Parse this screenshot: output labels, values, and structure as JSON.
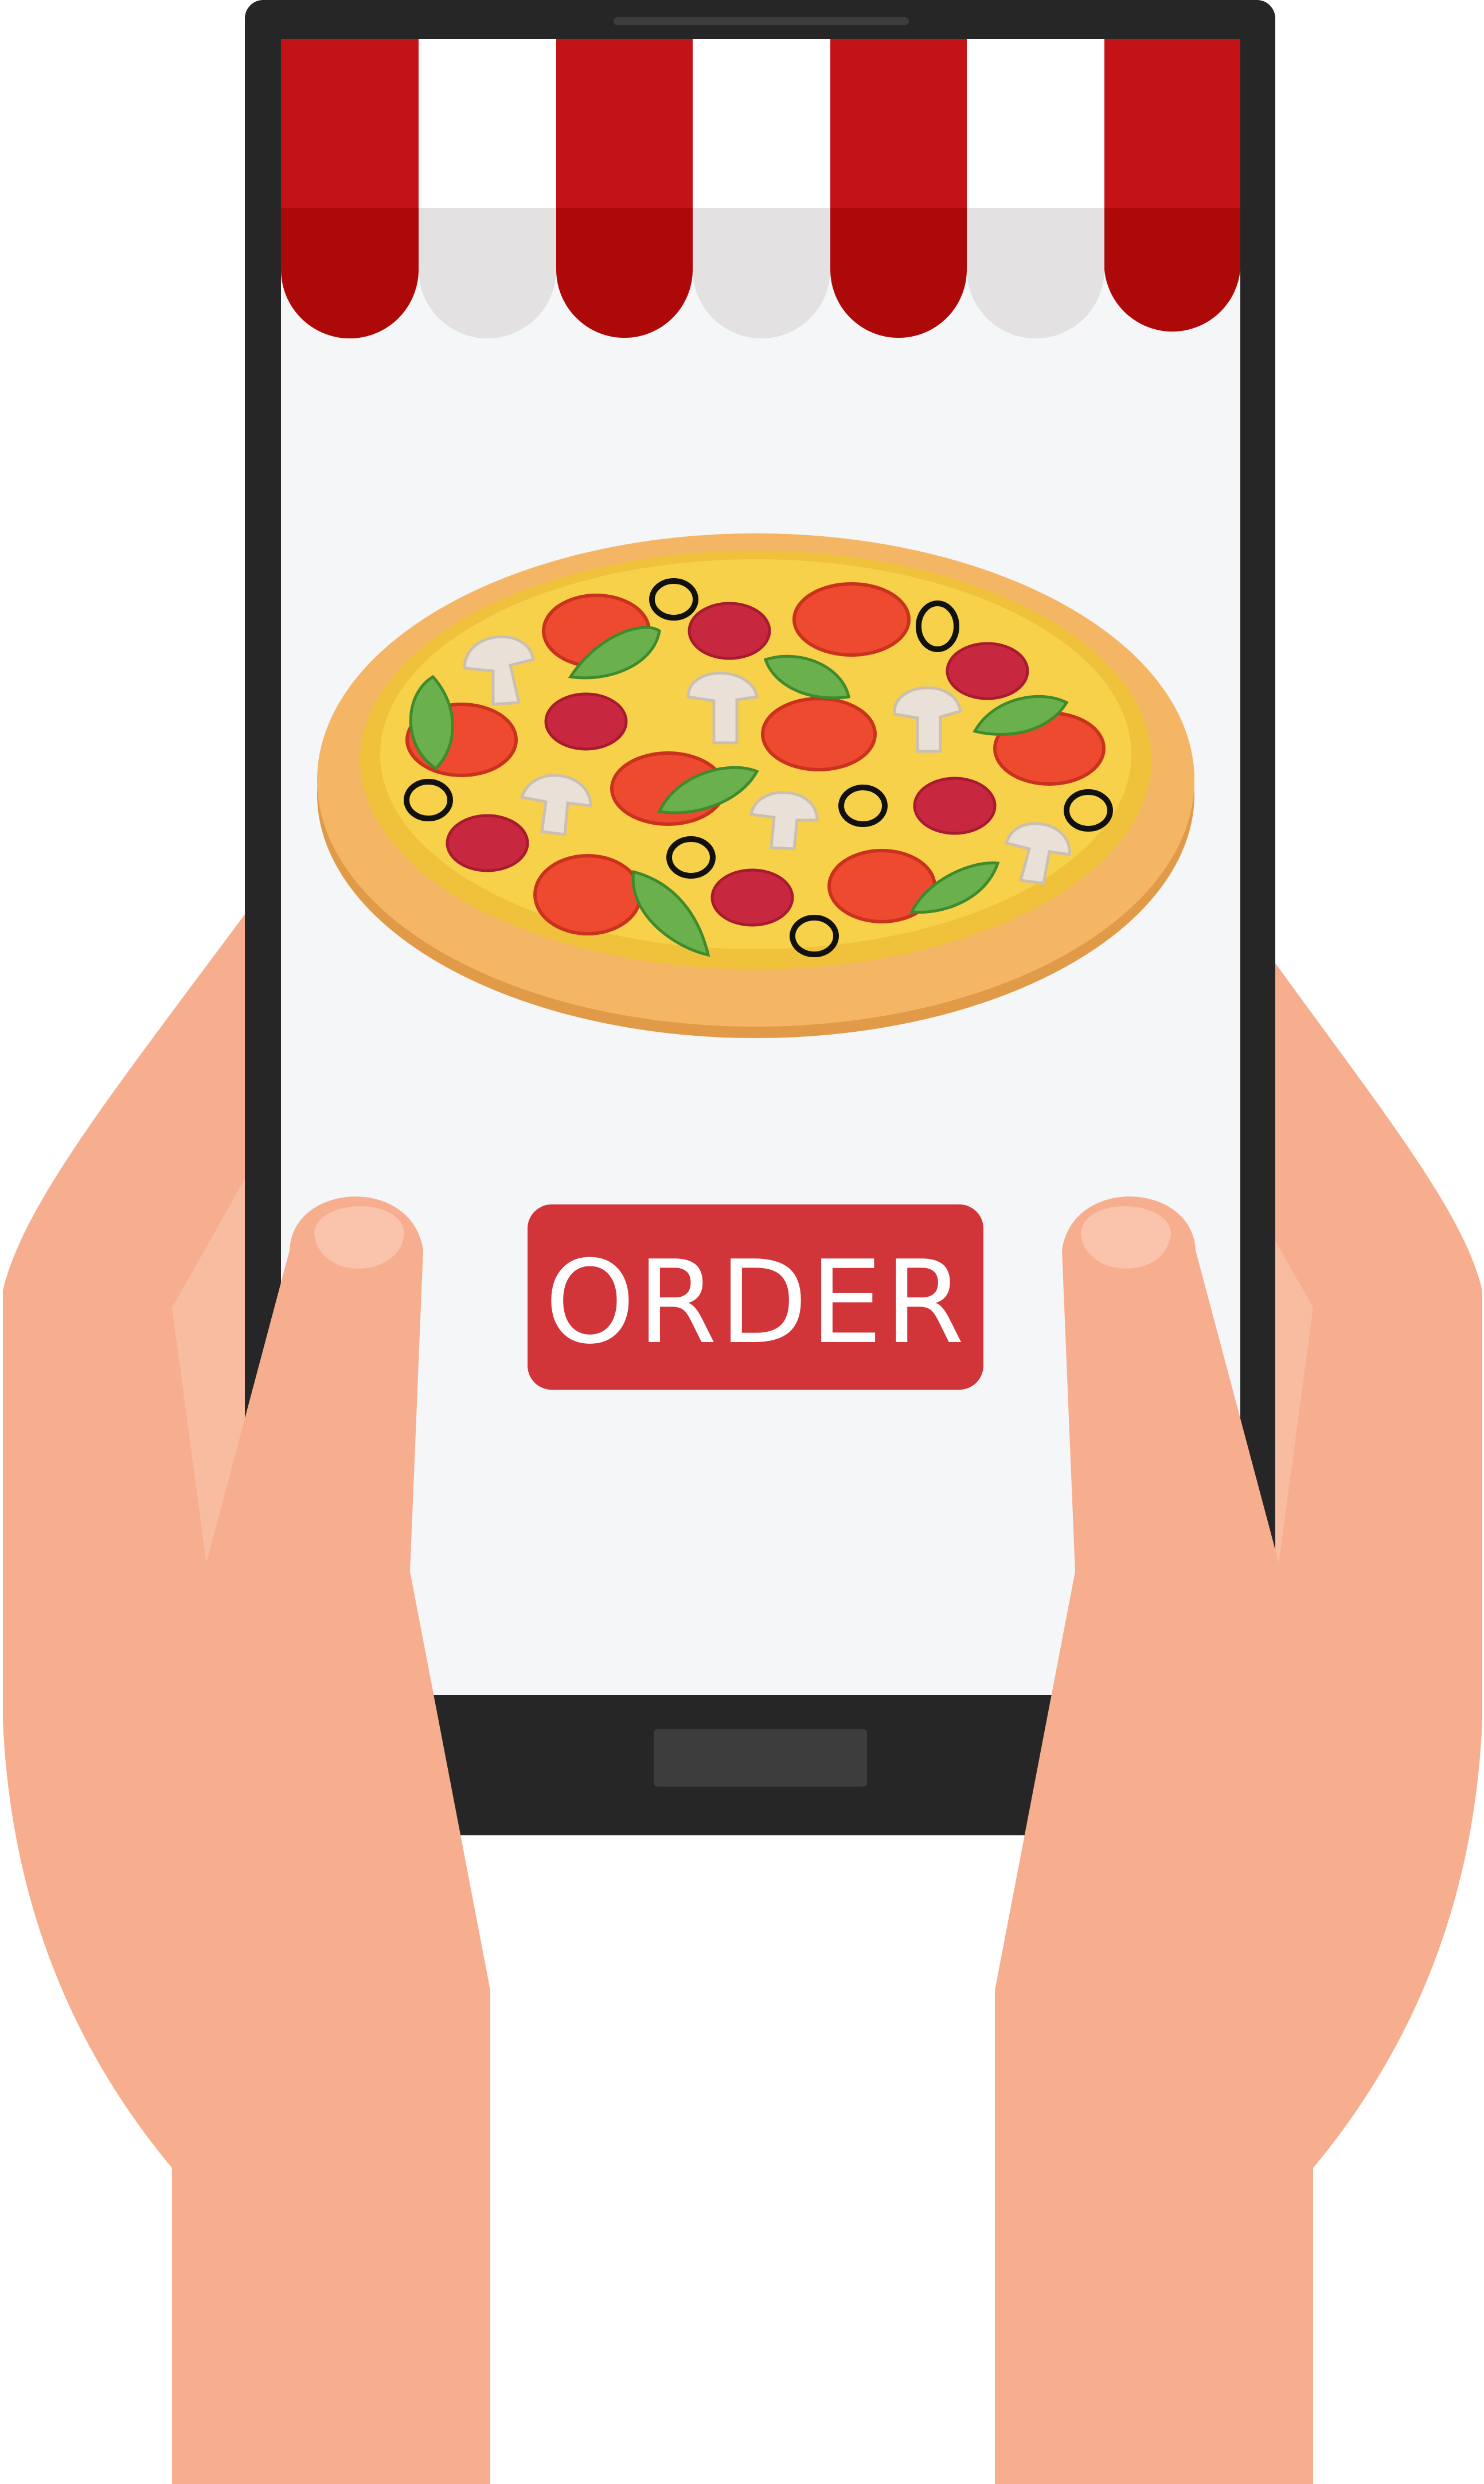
{
  "order_button": {
    "label": "ORDER"
  },
  "colors": {
    "phone_body": "#262626",
    "screen": "#f4f6f7",
    "awning_red": "#c41317",
    "awning_red_dark": "#ad0909",
    "awning_white": "#ffffff",
    "awning_white_shade": "#e3e1e2",
    "button_red": "#d13539",
    "skin": "#f7ae8e",
    "skin_light": "#f9c4ab",
    "crust": "#f4b565",
    "cheese": "#f7d14a",
    "tomato": "#ee4a2f",
    "salami": "#c8283f",
    "basil": "#6ab04c",
    "mushroom": "#e9e1d7",
    "olive": "#111111"
  },
  "icons": [
    "pizza-icon",
    "shop-awning-icon",
    "hand-icon",
    "smartphone-icon"
  ]
}
